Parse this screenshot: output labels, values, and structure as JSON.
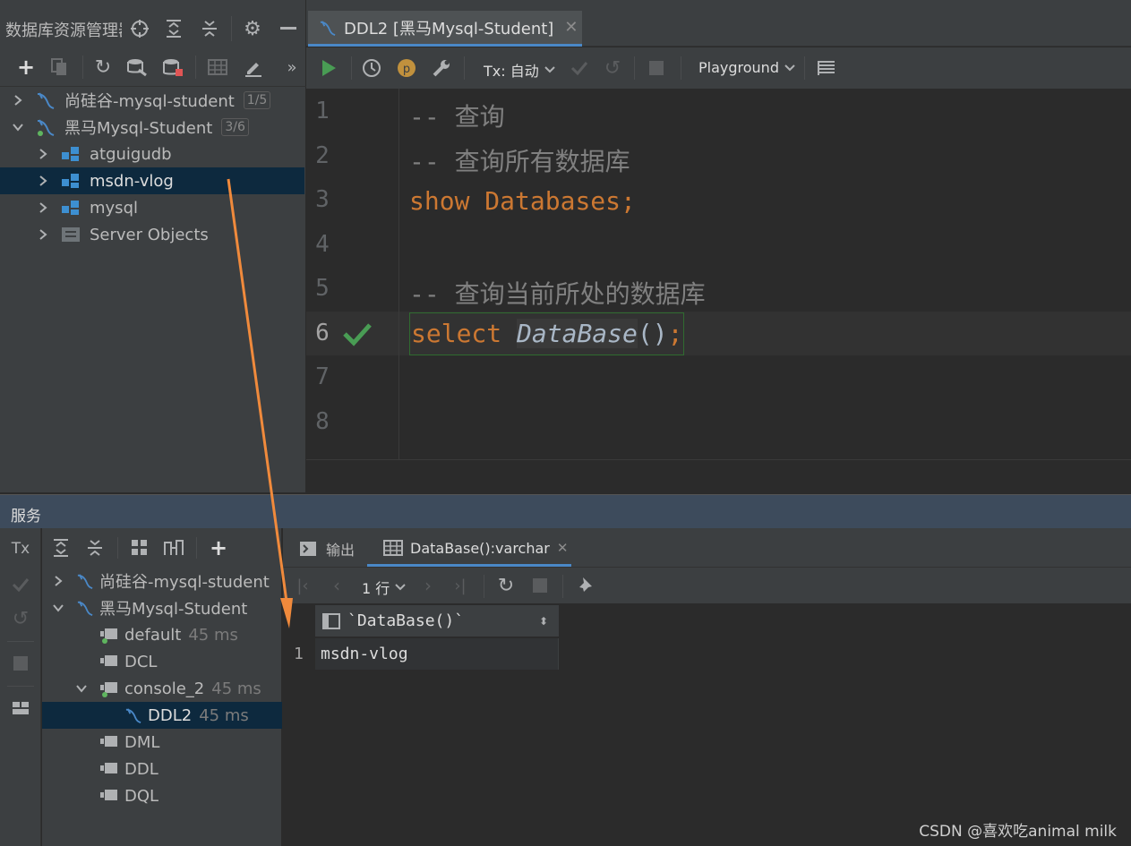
{
  "db_panel": {
    "title": "数据库资源管理器",
    "tree": [
      {
        "label": "尚硅谷-mysql-student",
        "badge": "1/5"
      },
      {
        "label": "黑马Mysql-Student",
        "badge": "3/6"
      },
      {
        "label": "atguigudb"
      },
      {
        "label": "msdn-vlog"
      },
      {
        "label": "mysql"
      },
      {
        "label": "Server Objects"
      }
    ]
  },
  "editor": {
    "tab_label": "DDL2 [黑马Mysql-Student]",
    "toolbar": {
      "tx_label": "Tx: 自动",
      "playground_label": "Playground"
    },
    "line_numbers": [
      "1",
      "2",
      "3",
      "4",
      "5",
      "6",
      "7",
      "8"
    ],
    "lines": [
      {
        "comment": "-- 查询"
      },
      {
        "comment": "-- 查询所有数据库"
      },
      {
        "keyword": "show",
        "rest": " Databases;"
      },
      {},
      {
        "comment": "-- 查询当前所处的数据库"
      },
      {
        "keyword": "select",
        "func": "DataBase",
        "paren": "()",
        "semi": ";"
      }
    ]
  },
  "services": {
    "title": "服务",
    "tx_label": "Tx",
    "tree": [
      {
        "label": "尚硅谷-mysql-student"
      },
      {
        "label": "黑马Mysql-Student"
      },
      {
        "label": "default",
        "ms": "45 ms"
      },
      {
        "label": "DCL"
      },
      {
        "label": "console_2",
        "ms": "45 ms"
      },
      {
        "label": "DDL2",
        "ms": "45 ms"
      },
      {
        "label": "DML"
      },
      {
        "label": "DDL"
      },
      {
        "label": "DQL"
      }
    ],
    "tabs": {
      "output": "输出",
      "result": "DataBase():varchar"
    },
    "rows_label": "1 行",
    "grid": {
      "header": "`DataBase()`",
      "row_num": "1",
      "value": "msdn-vlog"
    }
  },
  "watermark": "CSDN @喜欢吃animal milk",
  "colors": {
    "selection": "#0d293e",
    "accent": "#4a88c7",
    "run_green": "#499c54",
    "keyword": "#cc7832",
    "arrow": "#f08a3c"
  }
}
